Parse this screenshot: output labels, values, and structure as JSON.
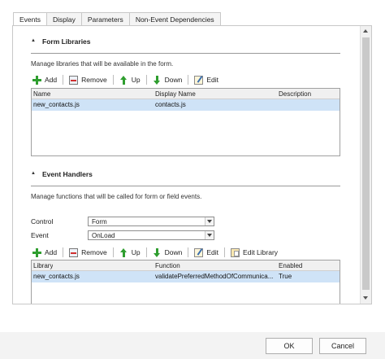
{
  "tabs": [
    {
      "label": "Events",
      "active": true
    },
    {
      "label": "Display",
      "active": false
    },
    {
      "label": "Parameters",
      "active": false
    },
    {
      "label": "Non-Event Dependencies",
      "active": false
    }
  ],
  "form_libraries": {
    "title": "Form Libraries",
    "description": "Manage libraries that will be available in the form.",
    "toolbar": {
      "add": "Add",
      "remove": "Remove",
      "up": "Up",
      "down": "Down",
      "edit": "Edit"
    },
    "columns": [
      "Name",
      "Display Name",
      "Description"
    ],
    "rows": [
      {
        "name": "new_contacts.js",
        "display_name": "contacts.js",
        "description": "",
        "selected": true
      }
    ]
  },
  "event_handlers": {
    "title": "Event Handlers",
    "description": "Manage functions that will be called for form or field events.",
    "control_label": "Control",
    "control_value": "Form",
    "event_label": "Event",
    "event_value": "OnLoad",
    "toolbar": {
      "add": "Add",
      "remove": "Remove",
      "up": "Up",
      "down": "Down",
      "edit": "Edit",
      "edit_library": "Edit Library"
    },
    "columns": [
      "Library",
      "Function",
      "Enabled"
    ],
    "rows": [
      {
        "library": "new_contacts.js",
        "function": "validatePreferredMethodOfCommunica...",
        "enabled": "True",
        "selected": true
      }
    ]
  },
  "footer": {
    "ok": "OK",
    "cancel": "Cancel"
  }
}
